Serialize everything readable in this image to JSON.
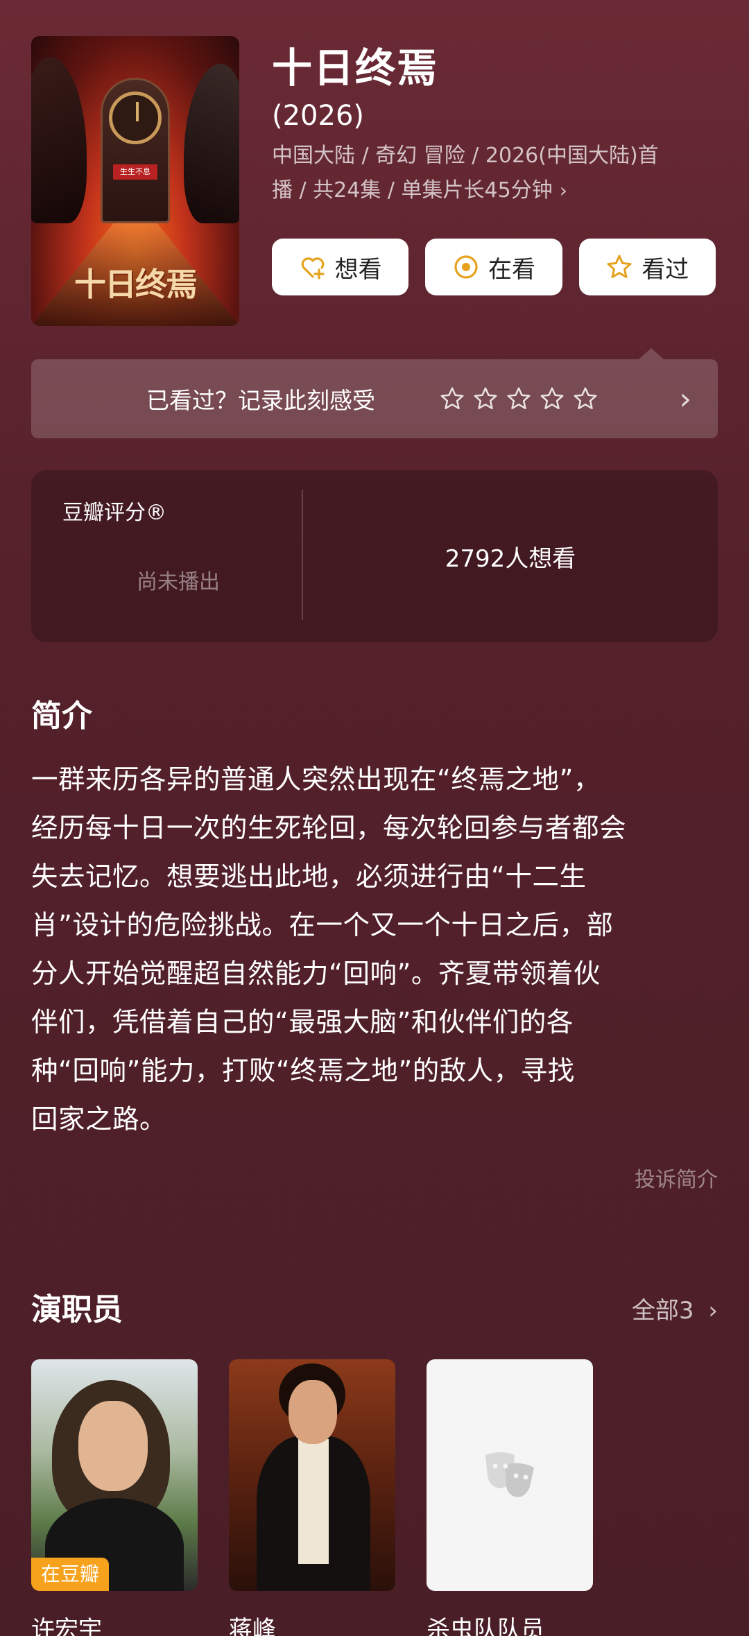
{
  "movie": {
    "title": "十日终焉",
    "year": "(2026)",
    "meta_line1": "中国大陆 / 奇幻 冒险 / 2026(中国大陆)首",
    "meta_line2": "播 / 共24集 / 单集片长45分钟",
    "meta_chevron": "›",
    "poster_sign": "生生不息",
    "poster_title": "十日终焉"
  },
  "actions": [
    {
      "label": "想看",
      "icon": "heart-plus-icon"
    },
    {
      "label": "在看",
      "icon": "target-icon"
    },
    {
      "label": "看过",
      "icon": "star-outline-icon"
    }
  ],
  "rate": {
    "prompt": "已看过？记录此刻感受",
    "stars_max": 5,
    "stars_filled": 0,
    "chevron": "›"
  },
  "score": {
    "label": "豆瓣评分®",
    "status": "尚未播出",
    "want_count": "2792人想看"
  },
  "synopsis": {
    "title": "简介",
    "lines": [
      "一群来历各异的普通人突然出现在“终焉之地”，",
      "经历每十日一次的生死轮回，每次轮回参与者都会",
      "失去记忆。想要逃出此地，必须进行由“十二生",
      "肖”设计的危险挑战。在一个又一个十日之后，部",
      "分人开始觉醒超自然能力“回响”。齐夏带领着伙",
      "伴们，凭借着自己的“最强大脑”和伙伴们的各",
      "种“回响”能力，打败“终焉之地”的敌人，寻找",
      "回家之路。"
    ],
    "complain": "投诉简介"
  },
  "cast": {
    "title": "演职员",
    "all_label": "全部3",
    "chevron": "›",
    "members": [
      {
        "name": "许宏宇",
        "badge": "在豆瓣"
      },
      {
        "name": "蒋峰",
        "badge": ""
      },
      {
        "name": "杀虫队队员",
        "badge": ""
      }
    ]
  },
  "colors": {
    "background": "#55212b",
    "accent_orange": "#f7a21d",
    "icon_gold": "#e6a21e"
  }
}
